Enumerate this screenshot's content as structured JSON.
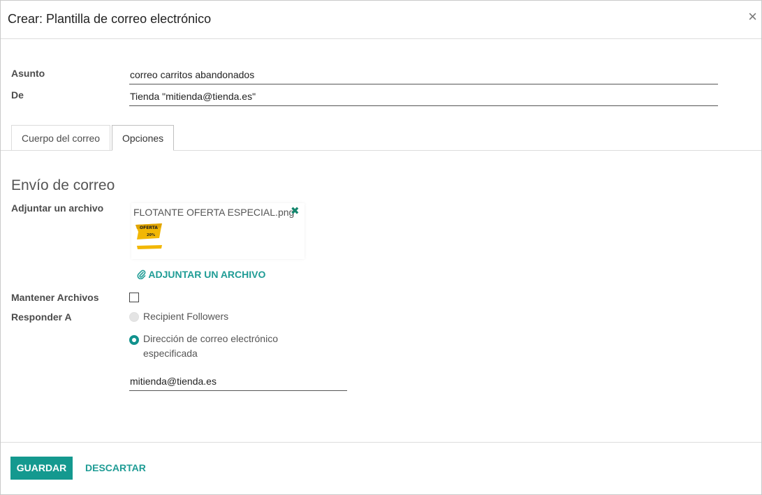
{
  "dialog": {
    "title": "Crear: Plantilla de correo electrónico",
    "close_icon": "×"
  },
  "form": {
    "subject_label": "Asunto",
    "subject_value": "correo carritos abandonados",
    "from_label": "De",
    "from_value": "Tienda \"mitienda@tienda.es\""
  },
  "tabs": [
    {
      "label": "Cuerpo del correo",
      "active": false
    },
    {
      "label": "Opciones",
      "active": true
    }
  ],
  "options": {
    "section_title": "Envío de correo",
    "attach_label": "Adjuntar un archivo",
    "attachment": {
      "filename": "FLOTANTE OFERTA ESPECIAL.png",
      "remove_icon": "✖",
      "thumb_text": "OFERTA",
      "thumb_sub": "20%"
    },
    "attach_button": "Adjuntar un archivo",
    "attach_icon": "paperclip-icon",
    "keep_files_label": "Mantener Archivos",
    "keep_files_checked": false,
    "reply_to_label": "Responder A",
    "reply_options": [
      {
        "label": "Recipient Followers",
        "checked": false,
        "disabled": true
      },
      {
        "label": "Dirección de correo electrónico especificada",
        "checked": true,
        "disabled": false
      }
    ],
    "reply_to_value": "mitienda@tienda.es"
  },
  "footer": {
    "save_label": "Guardar",
    "discard_label": "Descartar"
  },
  "colors": {
    "accent": "#14998f",
    "link": "#1f9c95",
    "remove": "#14866d"
  }
}
